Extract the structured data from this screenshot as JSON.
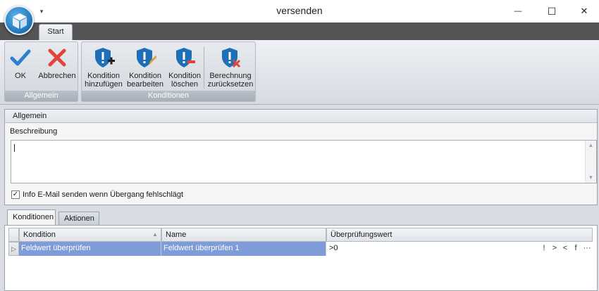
{
  "window": {
    "title": "versenden",
    "qat_symbol": "▾",
    "minimize": "—",
    "maximize": "☐",
    "close": "✕"
  },
  "ribbon": {
    "tab_start": "Start",
    "groups": {
      "allgemein": {
        "label": "Allgemein",
        "ok": "OK",
        "abbrechen": "Abbrechen"
      },
      "konditionen": {
        "label": "Konditionen",
        "add_line1": "Kondition",
        "add_line2": "hinzufügen",
        "edit_line1": "Kondition",
        "edit_line2": "bearbeiten",
        "delete_line1": "Kondition",
        "delete_line2": "löschen",
        "reset_line1": "Berechnung",
        "reset_line2": "zurücksetzen"
      }
    },
    "colors": {
      "accent_blue": "#1f6fb6",
      "check_blue": "#2d7fd0",
      "x_red": "#e0443a"
    },
    "icons": [
      "check-icon",
      "cross-icon",
      "shield-plus-icon",
      "shield-edit-icon",
      "shield-minus-icon",
      "shield-reset-icon",
      "app-logo-icon"
    ]
  },
  "general_panel": {
    "header": "Allgemein",
    "beschreibung_label": "Beschreibung",
    "beschreibung_value": "",
    "checkbox_label": "Info E-Mail senden wenn Übergang fehlschlägt",
    "checkbox_checked": true,
    "check_mark": "✓"
  },
  "bottom_tabs": {
    "konditionen": "Konditionen",
    "aktionen": "Aktionen"
  },
  "grid": {
    "columns": [
      "Kondition",
      "Name",
      "Überprüfungswert"
    ],
    "sort_indicator": "▲",
    "row_indicator": "▷",
    "rows": [
      {
        "kondition": "Feldwert überprüfen",
        "name": "Feldwert überprüfen 1",
        "value": ">0"
      }
    ],
    "operators": [
      "!",
      ">",
      "<",
      "f",
      "···"
    ]
  }
}
